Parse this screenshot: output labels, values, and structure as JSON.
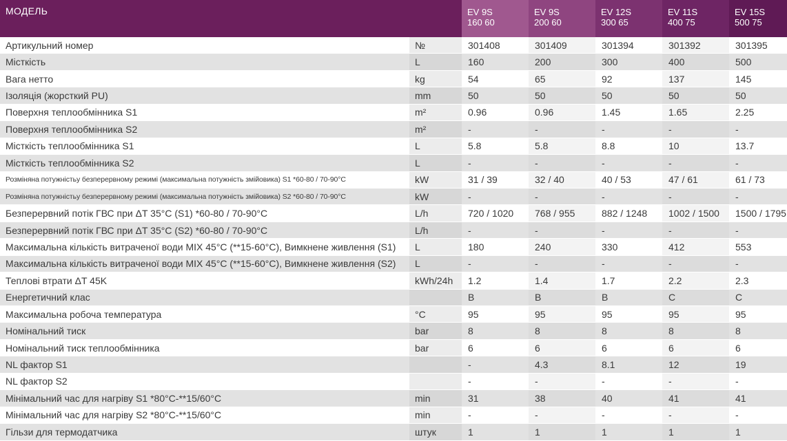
{
  "header": {
    "model_label": "МОДЕЛЬ",
    "unit_label": "",
    "models": [
      {
        "line1": "EV 9S",
        "line2": "160 60"
      },
      {
        "line1": "EV 9S",
        "line2": "200 60"
      },
      {
        "line1": "EV 12S",
        "line2": "300 65"
      },
      {
        "line1": "EV 11S",
        "line2": "400 75"
      },
      {
        "line1": "EV 15S",
        "line2": "500 75"
      }
    ]
  },
  "rows": [
    {
      "name": "Артикульний номер",
      "unit": "№",
      "values": [
        "301408",
        "301409",
        "301394",
        "301392",
        "301395"
      ]
    },
    {
      "name": "Місткість",
      "unit": "L",
      "values": [
        "160",
        "200",
        "300",
        "400",
        "500"
      ]
    },
    {
      "name": "Вага нетто",
      "unit": "kg",
      "values": [
        "54",
        "65",
        "92",
        "137",
        "145"
      ]
    },
    {
      "name": "Ізоляція (жорсткий PU)",
      "unit": "mm",
      "values": [
        "50",
        "50",
        "50",
        "50",
        "50"
      ]
    },
    {
      "name": "Поверхня теплообмінника S1",
      "unit": "m²",
      "values": [
        "0.96",
        "0.96",
        "1.45",
        "1.65",
        "2.25"
      ]
    },
    {
      "name": "Поверхня теплообмінника S2",
      "unit": "m²",
      "values": [
        "-",
        "-",
        "-",
        "-",
        "-"
      ]
    },
    {
      "name": "Місткість теплообмінника S1",
      "unit": "L",
      "values": [
        "5.8",
        "5.8",
        "8.8",
        "10",
        "13.7"
      ]
    },
    {
      "name": "Місткість теплообмінника S2",
      "unit": "L",
      "values": [
        "-",
        "-",
        "-",
        "-",
        "-"
      ]
    },
    {
      "name": "Розміняна потужністьу безперервному режимі (максимальна потужність змійовика) S1 *60-80 / 70-90°C",
      "unit": "kW",
      "small": true,
      "values": [
        "31 / 39",
        "32 / 40",
        "40 / 53",
        "47 / 61",
        "61 / 73"
      ]
    },
    {
      "name": "Розміняна потужністьу безперервному режимі (максимальна потужність змійовика) S2 *60-80 / 70-90°C",
      "unit": "kW",
      "small": true,
      "values": [
        "-",
        "-",
        "-",
        "-",
        "-"
      ]
    },
    {
      "name": "Безперервний потік ГВС при ΔT 35°C (S1) *60-80 / 70-90°C",
      "unit": "L/h",
      "values": [
        "720 / 1020",
        "768 / 955",
        "882 / 1248",
        "1002 / 1500",
        "1500 / 1795"
      ]
    },
    {
      "name": "Безперервний потік ГВС при ΔT 35°C (S2) *60-80 / 70-90°C",
      "unit": "L/h",
      "values": [
        "-",
        "-",
        "-",
        "-",
        "-"
      ]
    },
    {
      "name": "Максимальна кількість витраченої води MIX 45°C (**15-60°C), Вимкнене живлення (S1)",
      "unit": "L",
      "values": [
        "180",
        "240",
        "330",
        "412",
        "553"
      ]
    },
    {
      "name": "Максимальна кількість витраченої води MIX 45°C (**15-60°C), Вимкнене живлення (S2)",
      "unit": "L",
      "values": [
        "-",
        "-",
        "-",
        "-",
        "-"
      ]
    },
    {
      "name": "Теплові втрати ΔT 45K",
      "unit": "kWh/24h",
      "values": [
        "1.2",
        "1.4",
        "1.7",
        "2.2",
        "2.3"
      ]
    },
    {
      "name": "Енергетичний клас",
      "unit": "",
      "values": [
        "B",
        "B",
        "B",
        "C",
        "C"
      ]
    },
    {
      "name": "Максимальна робоча температура",
      "unit": "°C",
      "values": [
        "95",
        "95",
        "95",
        "95",
        "95"
      ]
    },
    {
      "name": "Номінальний тиск",
      "unit": "bar",
      "values": [
        "8",
        "8",
        "8",
        "8",
        "8"
      ]
    },
    {
      "name": "Номінальний тиск теплообмінника",
      "unit": "bar",
      "values": [
        "6",
        "6",
        "6",
        "6",
        "6"
      ]
    },
    {
      "name": "NL фактор S1",
      "unit": "",
      "values": [
        "-",
        "4.3",
        "8.1",
        "12",
        "19"
      ]
    },
    {
      "name": "NL фактор S2",
      "unit": "",
      "values": [
        "-",
        "-",
        "-",
        "-",
        "-"
      ]
    },
    {
      "name": "Мінімальний час для нагріву S1 *80°C-**15/60°C",
      "unit": "min",
      "values": [
        "31",
        "38",
        "40",
        "41",
        "41"
      ]
    },
    {
      "name": "Мінімальний час для нагріву S2 *80°C-**15/60°C",
      "unit": "min",
      "values": [
        "-",
        "-",
        "-",
        "-",
        "-"
      ]
    },
    {
      "name": "Гільзи для термодатчика",
      "unit": "штук",
      "values": [
        "1",
        "1",
        "1",
        "1",
        "1"
      ]
    }
  ]
}
